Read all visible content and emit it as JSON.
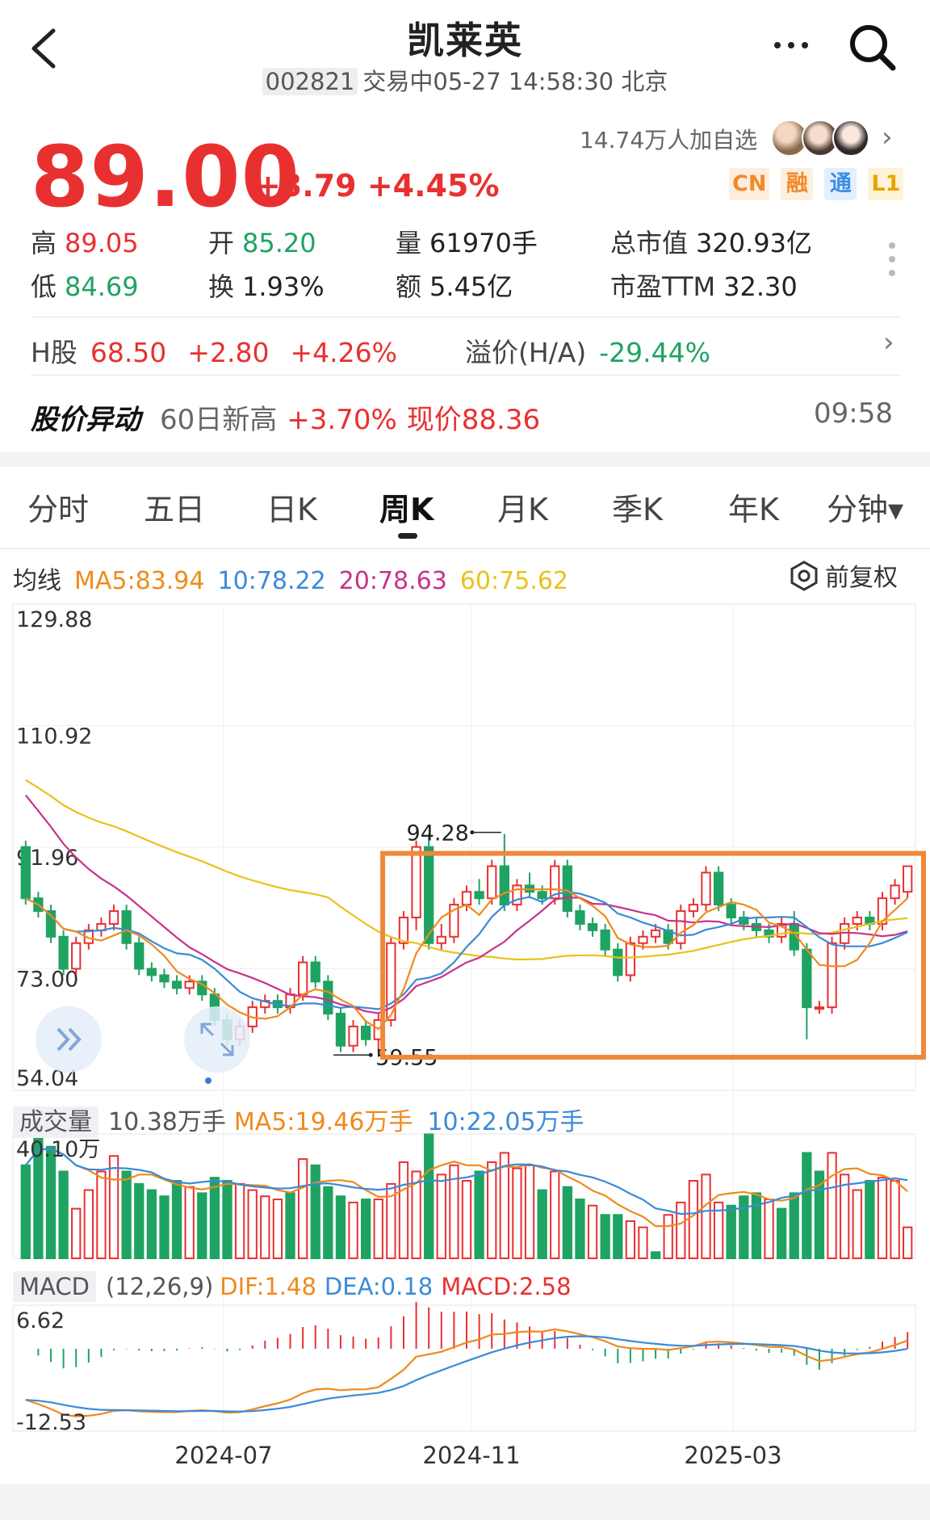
{
  "header": {
    "title": "凯莱英",
    "code": "002821",
    "status": "交易中05-27 14:58:30 北京"
  },
  "quote": {
    "price": "89.00",
    "change": "+3.79",
    "change_pct": "+4.45%",
    "watch_count": "14.74万人加自选",
    "badges": [
      {
        "label": "CN",
        "color": "#f08a2c",
        "bg": "#fdeede"
      },
      {
        "label": "融",
        "color": "#f08a2c",
        "bg": "#fdeede"
      },
      {
        "label": "通",
        "color": "#3a8ee6",
        "bg": "#e3effc"
      },
      {
        "label": "L1",
        "color": "#e9a400",
        "bg": "#fdf3d6"
      }
    ],
    "high_label": "高",
    "high": "89.05",
    "low_label": "低",
    "low": "84.69",
    "open_label": "开",
    "open": "85.20",
    "turnover_label": "换",
    "turnover": "1.93%",
    "volume_label": "量",
    "volume": "61970手",
    "amount_label": "额",
    "amount": "5.45亿",
    "mktcap_label": "总市值",
    "mktcap": "320.93亿",
    "pe_label": "市盈TTM",
    "pe": "32.30"
  },
  "hshare": {
    "label": "H股",
    "price": "68.50",
    "change": "+2.80",
    "change_pct": "+4.26%",
    "premium_label": "溢价(H/A)",
    "premium": "-29.44%"
  },
  "alert": {
    "title": "股价异动",
    "desc": "60日新高",
    "pct": "+3.70%",
    "now": "现价88.36",
    "time": "09:58"
  },
  "tabs": [
    "分时",
    "五日",
    "日K",
    "周K",
    "月K",
    "季K",
    "年K",
    "分钟▾"
  ],
  "active_tab": "周K",
  "ma_legend": {
    "label": "均线",
    "ma5": "MA5:83.94",
    "ma10": "10:78.22",
    "ma20": "20:78.63",
    "ma60": "60:75.62",
    "adjust": "前复权"
  },
  "volume_legend": {
    "label": "成交量",
    "value": "10.38万手",
    "ma5": "MA5:19.46万手",
    "ma10": "10:22.05万手"
  },
  "macd_legend": {
    "label": "MACD",
    "params": "(12,26,9)",
    "dif": "DIF:1.48",
    "dea": "DEA:0.18",
    "macd": "MACD:2.58"
  },
  "colors": {
    "up": "#e93030",
    "down": "#1fa363",
    "ma5": "#f08a1c",
    "ma10": "#3b8ad8",
    "ma20": "#c8338a",
    "ma60": "#e8c21a",
    "highlight": "#f0883a"
  },
  "chart_data": {
    "type": "candlestick",
    "price_axis_ticks": [
      "129.88",
      "110.92",
      "91.96",
      "73.00",
      "54.04"
    ],
    "price_axis_values": [
      129.88,
      110.92,
      91.96,
      73.0,
      54.04
    ],
    "high_marker": "94.28",
    "low_marker": "59.55",
    "volume_axis_max": "40.10万",
    "macd_axis": [
      "6.62",
      "-12.53"
    ],
    "x_ticks": [
      "2024-07",
      "2024-11",
      "2025-03"
    ],
    "candles": [
      [
        92,
        84,
        93,
        83
      ],
      [
        84,
        82,
        85,
        81
      ],
      [
        82,
        78,
        83,
        77
      ],
      [
        78,
        73,
        79,
        72
      ],
      [
        73,
        77,
        78,
        72
      ],
      [
        77,
        79,
        80,
        76
      ],
      [
        79,
        80,
        81,
        78
      ],
      [
        80,
        82,
        83,
        79
      ],
      [
        82,
        77,
        83,
        76
      ],
      [
        77,
        73,
        78,
        72
      ],
      [
        73,
        72,
        74,
        71
      ],
      [
        72,
        71,
        73,
        70
      ],
      [
        71,
        70,
        72,
        69
      ],
      [
        70,
        71,
        72,
        69
      ],
      [
        71,
        69,
        72,
        68
      ],
      [
        69,
        65,
        70,
        64
      ],
      [
        65,
        62,
        66,
        61
      ],
      [
        62,
        64,
        65,
        61
      ],
      [
        64,
        67,
        68,
        63
      ],
      [
        67,
        68,
        69,
        66
      ],
      [
        68,
        67,
        69,
        66
      ],
      [
        67,
        69,
        70,
        66
      ],
      [
        69,
        74,
        75,
        68
      ],
      [
        74,
        71,
        75,
        70
      ],
      [
        71,
        66,
        72,
        65
      ],
      [
        66,
        61,
        67,
        60
      ],
      [
        61,
        64,
        65,
        60
      ],
      [
        64,
        62,
        65,
        61
      ],
      [
        62,
        65,
        66,
        60
      ],
      [
        65,
        77,
        78,
        64
      ],
      [
        77,
        81,
        82,
        76
      ],
      [
        81,
        92,
        93,
        79
      ],
      [
        92,
        77,
        94,
        76
      ],
      [
        77,
        78,
        80,
        76
      ],
      [
        78,
        83,
        84,
        77
      ],
      [
        83,
        85,
        86,
        82
      ],
      [
        85,
        84,
        87,
        83
      ],
      [
        84,
        89,
        90,
        83
      ],
      [
        89,
        83,
        94,
        82
      ],
      [
        83,
        86,
        87,
        82
      ],
      [
        86,
        85,
        88,
        84
      ],
      [
        85,
        84,
        86,
        83
      ],
      [
        84,
        89,
        90,
        83
      ],
      [
        89,
        82,
        90,
        81
      ],
      [
        82,
        80,
        83,
        79
      ],
      [
        80,
        79,
        81,
        78
      ],
      [
        79,
        76,
        80,
        75
      ],
      [
        76,
        72,
        77,
        71
      ],
      [
        72,
        77,
        78,
        71
      ],
      [
        77,
        78,
        79,
        76
      ],
      [
        78,
        79,
        80,
        77
      ],
      [
        79,
        77,
        80,
        76
      ],
      [
        77,
        82,
        83,
        76
      ],
      [
        82,
        83,
        84,
        81
      ],
      [
        83,
        88,
        89,
        82
      ],
      [
        88,
        83,
        89,
        82
      ],
      [
        83,
        81,
        84,
        80
      ],
      [
        81,
        80,
        82,
        79
      ],
      [
        80,
        79,
        81,
        78
      ],
      [
        79,
        78,
        80,
        77
      ],
      [
        78,
        80,
        81,
        77
      ],
      [
        80,
        76,
        82,
        75
      ],
      [
        76,
        67,
        77,
        62
      ],
      [
        67,
        67,
        68,
        66
      ],
      [
        67,
        77,
        78,
        66
      ],
      [
        77,
        80,
        81,
        76
      ],
      [
        80,
        81,
        82,
        79
      ],
      [
        81,
        80,
        82,
        79
      ],
      [
        80,
        84,
        85,
        79
      ],
      [
        84,
        86,
        87,
        83
      ],
      [
        85,
        89,
        89,
        84
      ]
    ],
    "volumes": [
      [
        30,
        "d"
      ],
      [
        40,
        "d"
      ],
      [
        36,
        "d"
      ],
      [
        28,
        "d"
      ],
      [
        16,
        "u"
      ],
      [
        22,
        "u"
      ],
      [
        28,
        "u"
      ],
      [
        33,
        "u"
      ],
      [
        28,
        "d"
      ],
      [
        24,
        "d"
      ],
      [
        22,
        "d"
      ],
      [
        20,
        "d"
      ],
      [
        25,
        "d"
      ],
      [
        23,
        "u"
      ],
      [
        21,
        "d"
      ],
      [
        26,
        "d"
      ],
      [
        25,
        "d"
      ],
      [
        24,
        "u"
      ],
      [
        22,
        "u"
      ],
      [
        20,
        "u"
      ],
      [
        19,
        "u"
      ],
      [
        21,
        "d"
      ],
      [
        32,
        "u"
      ],
      [
        30,
        "d"
      ],
      [
        23,
        "d"
      ],
      [
        20,
        "d"
      ],
      [
        18,
        "u"
      ],
      [
        19,
        "d"
      ],
      [
        19,
        "u"
      ],
      [
        24,
        "u"
      ],
      [
        31,
        "u"
      ],
      [
        28,
        "u"
      ],
      [
        40,
        "d"
      ],
      [
        27,
        "u"
      ],
      [
        30,
        "u"
      ],
      [
        25,
        "u"
      ],
      [
        28,
        "d"
      ],
      [
        31,
        "u"
      ],
      [
        34,
        "u"
      ],
      [
        29,
        "u"
      ],
      [
        30,
        "u"
      ],
      [
        22,
        "d"
      ],
      [
        28,
        "u"
      ],
      [
        23,
        "d"
      ],
      [
        19,
        "d"
      ],
      [
        17,
        "u"
      ],
      [
        14,
        "d"
      ],
      [
        14,
        "d"
      ],
      [
        12,
        "u"
      ],
      [
        10,
        "u"
      ],
      [
        2,
        "d"
      ],
      [
        14,
        "u"
      ],
      [
        18,
        "u"
      ],
      [
        25,
        "u"
      ],
      [
        27,
        "u"
      ],
      [
        18,
        "u"
      ],
      [
        17,
        "d"
      ],
      [
        20,
        "d"
      ],
      [
        21,
        "d"
      ],
      [
        19,
        "u"
      ],
      [
        16,
        "d"
      ],
      [
        21,
        "d"
      ],
      [
        34,
        "d"
      ],
      [
        28,
        "d"
      ],
      [
        34,
        "u"
      ],
      [
        27,
        "u"
      ],
      [
        22,
        "u"
      ],
      [
        25,
        "d"
      ],
      [
        26,
        "u"
      ],
      [
        25,
        "u"
      ],
      [
        10,
        "u"
      ]
    ]
  }
}
